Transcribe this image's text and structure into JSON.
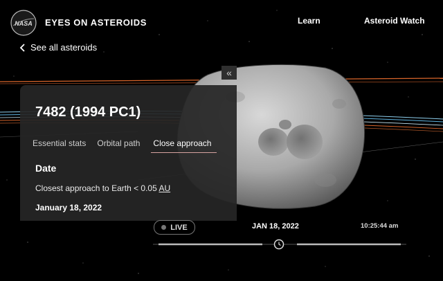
{
  "header": {
    "logo_text": "NASA",
    "app_title": "EYES ON ASTEROIDS",
    "nav": {
      "learn": "Learn",
      "asteroid_watch": "Asteroid Watch"
    }
  },
  "back_link": {
    "label": "See all asteroids",
    "icon": "chevron-left-icon"
  },
  "collapse_button": {
    "label": "«"
  },
  "panel": {
    "title": "7482 (1994 PC1)",
    "tabs": [
      {
        "label": "Essential stats",
        "active": false
      },
      {
        "label": "Orbital path",
        "active": false
      },
      {
        "label": "Close approach",
        "active": true
      }
    ],
    "section_heading": "Date",
    "approach_prefix": "Closest approach to Earth < 0.05 ",
    "approach_unit": "AU",
    "approach_date": "January 18, 2022"
  },
  "timeline": {
    "live_label": "LIVE",
    "date": "JAN 18, 2022",
    "time": "10:25:44 am"
  },
  "colors": {
    "panel_bg": "#262626",
    "active_tab_underline": "#d7a3a0",
    "orbit_orange": "#d9652a",
    "orbit_blue": "#5fb4e0"
  }
}
